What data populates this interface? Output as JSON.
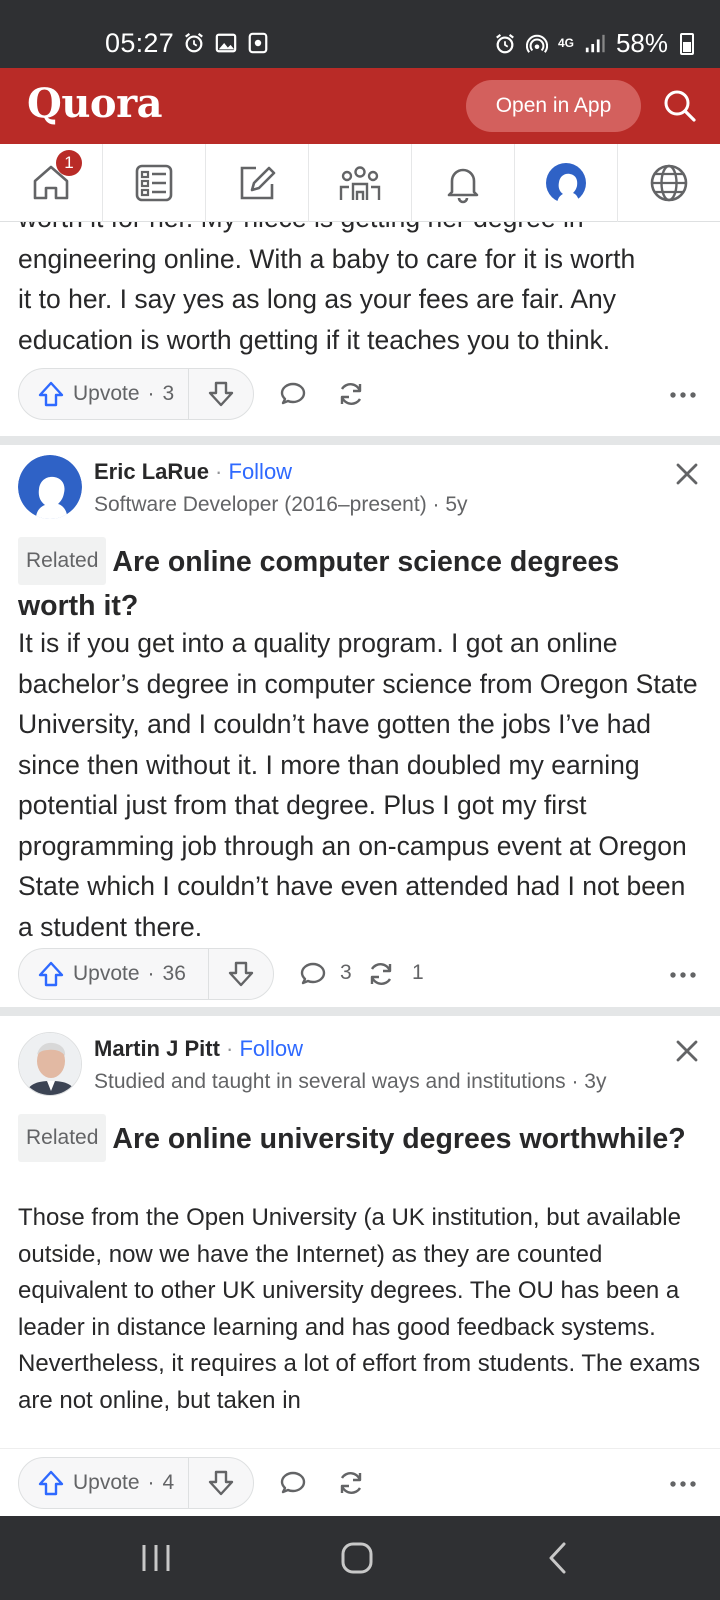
{
  "status_bar": {
    "time": "05:27",
    "network": "4G",
    "battery": "58%"
  },
  "header": {
    "logo": "Quora",
    "open_in_app": "Open in App",
    "brand_color": "#b92b27"
  },
  "nav": {
    "home_badge": "1",
    "tabs": [
      "home-icon",
      "following-icon",
      "write-icon",
      "spaces-icon",
      "notifications-icon",
      "profile-icon",
      "languages-icon"
    ]
  },
  "answers": [
    {
      "body_lines": [
        "worth it for her. My niece is getting her degree in",
        "engineering online. With a baby to care for it is worth",
        "it to her. I say yes as long as your fees are fair. Any",
        "education is worth getting if it teaches you to think."
      ],
      "upvote_label": "Upvote",
      "upvote_count": "3",
      "comment_count": "",
      "share_count": ""
    },
    {
      "author_name": "Eric LaRue",
      "follow_label": "Follow",
      "credential": "Software Developer (2016–present) · 5y",
      "related_label": "Related",
      "question": "Are online computer science degrees worth it?",
      "body": "It is if you get into a quality program. I got an online bachelor’s degree in computer science from Oregon State University, and I couldn’t have gotten the jobs I’ve had since then without it. I more than doubled my earning potential just from that degree. Plus I got my first programming job through an on-campus event at Oregon State which I couldn’t have even attended had I not been a student there.",
      "upvote_label": "Upvote",
      "upvote_count": "36",
      "comment_count": "3",
      "share_count": "1"
    },
    {
      "author_name": "Martin J Pitt",
      "follow_label": "Follow",
      "credential": "Studied and taught in several ways and institutions · 3y",
      "related_label": "Related",
      "question": "Are online university degrees worthwhile?",
      "body": "Those from the Open University (a UK institution, but available outside, now we have the Internet) as they are counted equivalent to other UK university degrees. The OU has been a leader in distance learning and has good feedback systems. Nevertheless, it requires a lot of effort from students. The exams are not online, but taken in",
      "upvote_label": "Upvote",
      "upvote_count": "4",
      "comment_count": "",
      "share_count": ""
    }
  ]
}
